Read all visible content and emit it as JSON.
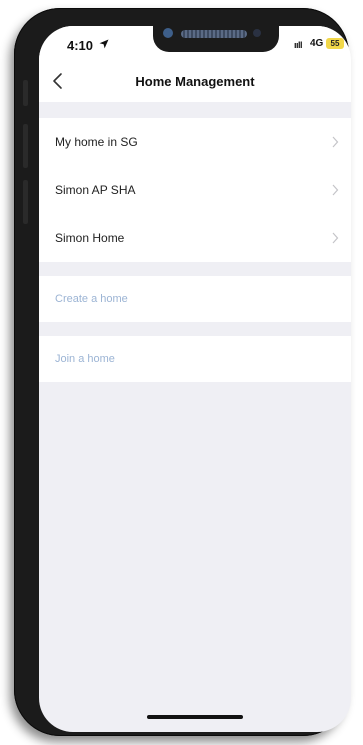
{
  "status_bar": {
    "time": "4:10",
    "signal": "ııll",
    "network": "4G",
    "battery": "55"
  },
  "navbar": {
    "title": "Home Management"
  },
  "homes": [
    {
      "label": "My home in SG"
    },
    {
      "label": "Simon AP SHA"
    },
    {
      "label": "Simon Home"
    }
  ],
  "actions": {
    "create": "Create a home",
    "join": "Join a home"
  },
  "colors": {
    "background": "#efeff4",
    "link": "#9cb4d4",
    "battery": "#f2d84a"
  },
  "icons": {
    "back": "chevron-left-icon",
    "row": "chevron-right-icon",
    "location": "location-arrow-icon"
  }
}
